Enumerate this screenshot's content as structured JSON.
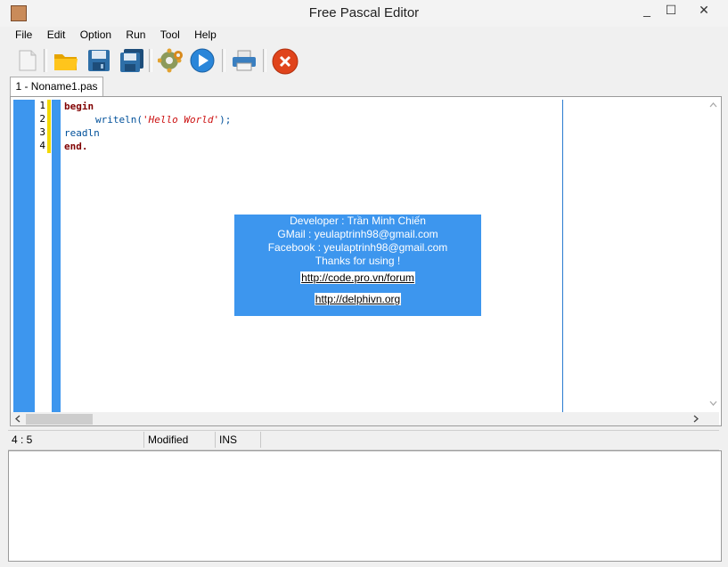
{
  "window": {
    "title": "Free Pascal Editor",
    "minimize": "_",
    "maximize": "☐",
    "close": "✕"
  },
  "menu": [
    "File",
    "Edit",
    "Option",
    "Run",
    "Tool",
    "Help"
  ],
  "tab": {
    "label": "1 - Noname1.pas"
  },
  "editor": {
    "line_numbers": [
      "1",
      "2",
      "3",
      "4"
    ],
    "code": {
      "line1": "begin",
      "line2_fn": "writeln(",
      "line2_str": "'Hello World'",
      "line2_end": ");",
      "line3": "readln",
      "line4": "end."
    }
  },
  "about": {
    "developer": "Developer : Trần Minh Chiến",
    "gmail": "GMail : yeulaptrinh98@gmail.com",
    "facebook": "Facebook : yeulaptrinh98@gmail.com",
    "thanks": "Thanks for using !",
    "link1": "http://code.pro.vn/forum",
    "link2": "http://delphivn.org"
  },
  "status": {
    "position": "4 : 5",
    "state": "Modified",
    "mode": "INS"
  },
  "colors": {
    "accent": "#3d96ee",
    "keyword": "#800000",
    "identifier": "#00509a",
    "string": "#cc1111",
    "modified_marker": "#f2d800"
  },
  "icons": [
    "new-file-icon",
    "open-folder-icon",
    "save-icon",
    "save-all-icon",
    "compile-gear-icon",
    "run-play-icon",
    "print-icon",
    "stop-icon"
  ]
}
